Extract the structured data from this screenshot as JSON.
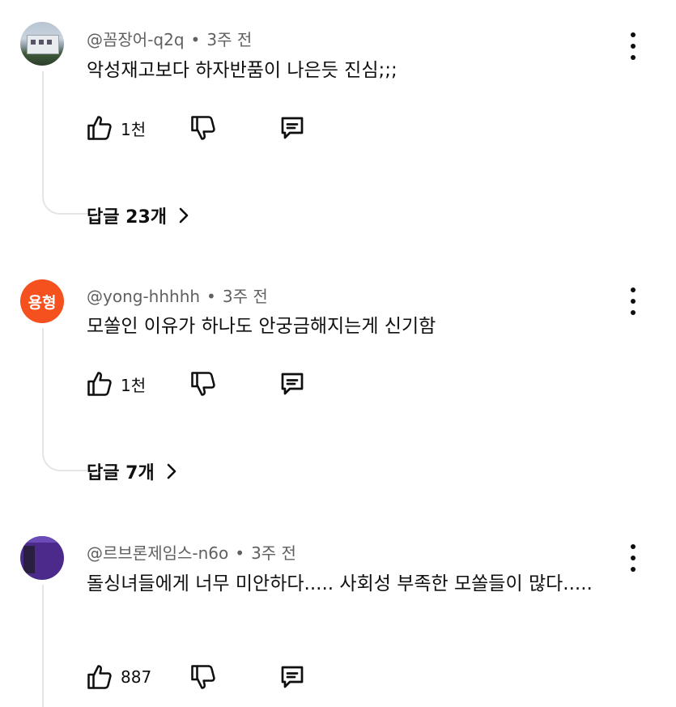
{
  "comments": [
    {
      "handle": "@꼼장어-q2q",
      "time": "3주 전",
      "text": "악성재고보다 하자반품이 나은듯 진심;;;",
      "likes": "1천",
      "replies_label": "답글 23개",
      "avatar": "photo"
    },
    {
      "handle": "@yong-hhhhh",
      "time": "3주 전",
      "text": "모쏠인 이유가 하나도 안궁금해지는게 신기함",
      "likes": "1천",
      "replies_label": "답글 7개",
      "avatar": "letters",
      "avatar_letters": "용형",
      "avatar_color": "#f4511e"
    },
    {
      "handle": "@르브론제임스-n6o",
      "time": "3주 전",
      "text": "돌싱녀들에게 너무 미안하다..... 사회성 부족한 모쏠들이 많다.....",
      "likes": "887",
      "avatar": "purple"
    }
  ],
  "separator": "•",
  "icons": {
    "like": "thumbs-up-icon",
    "dislike": "thumbs-down-icon",
    "reply": "comment-icon",
    "more": "more-vert-icon",
    "expand": "chevron-right-icon"
  }
}
